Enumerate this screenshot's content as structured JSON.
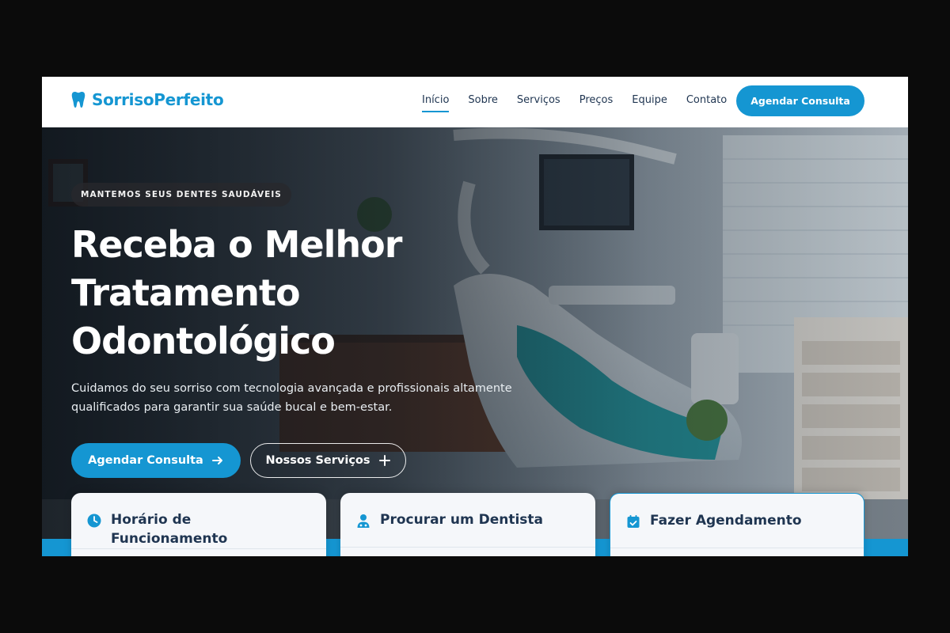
{
  "brand": {
    "name": "SorrisoPerfeito",
    "icon": "tooth-icon",
    "color": "#1596d2"
  },
  "nav": {
    "items": [
      {
        "label": "Início",
        "active": true
      },
      {
        "label": "Sobre"
      },
      {
        "label": "Serviços"
      },
      {
        "label": "Preços"
      },
      {
        "label": "Equipe"
      },
      {
        "label": "Contato"
      }
    ],
    "cta": "Agendar Consulta"
  },
  "hero": {
    "badge": "MANTEMOS SEUS DENTES SAUDÁVEIS",
    "title": "Receba o Melhor Tratamento Odontológico",
    "description": "Cuidamos do seu sorriso com tecnologia avançada e profissionais altamente qualificados para garantir sua saúde bucal e bem-estar.",
    "primary_button": "Agendar Consulta",
    "primary_icon": "arrow-right-icon",
    "secondary_button": "Nossos Serviços",
    "secondary_icon": "plus-icon"
  },
  "cards": [
    {
      "title": "Horário de Funcionamento",
      "icon": "clock-icon"
    },
    {
      "title": "Procurar um Dentista",
      "icon": "doctor-icon"
    },
    {
      "title": "Fazer Agendamento",
      "icon": "calendar-check-icon"
    }
  ],
  "colors": {
    "accent": "#1596d2",
    "heading": "#1f3551"
  }
}
